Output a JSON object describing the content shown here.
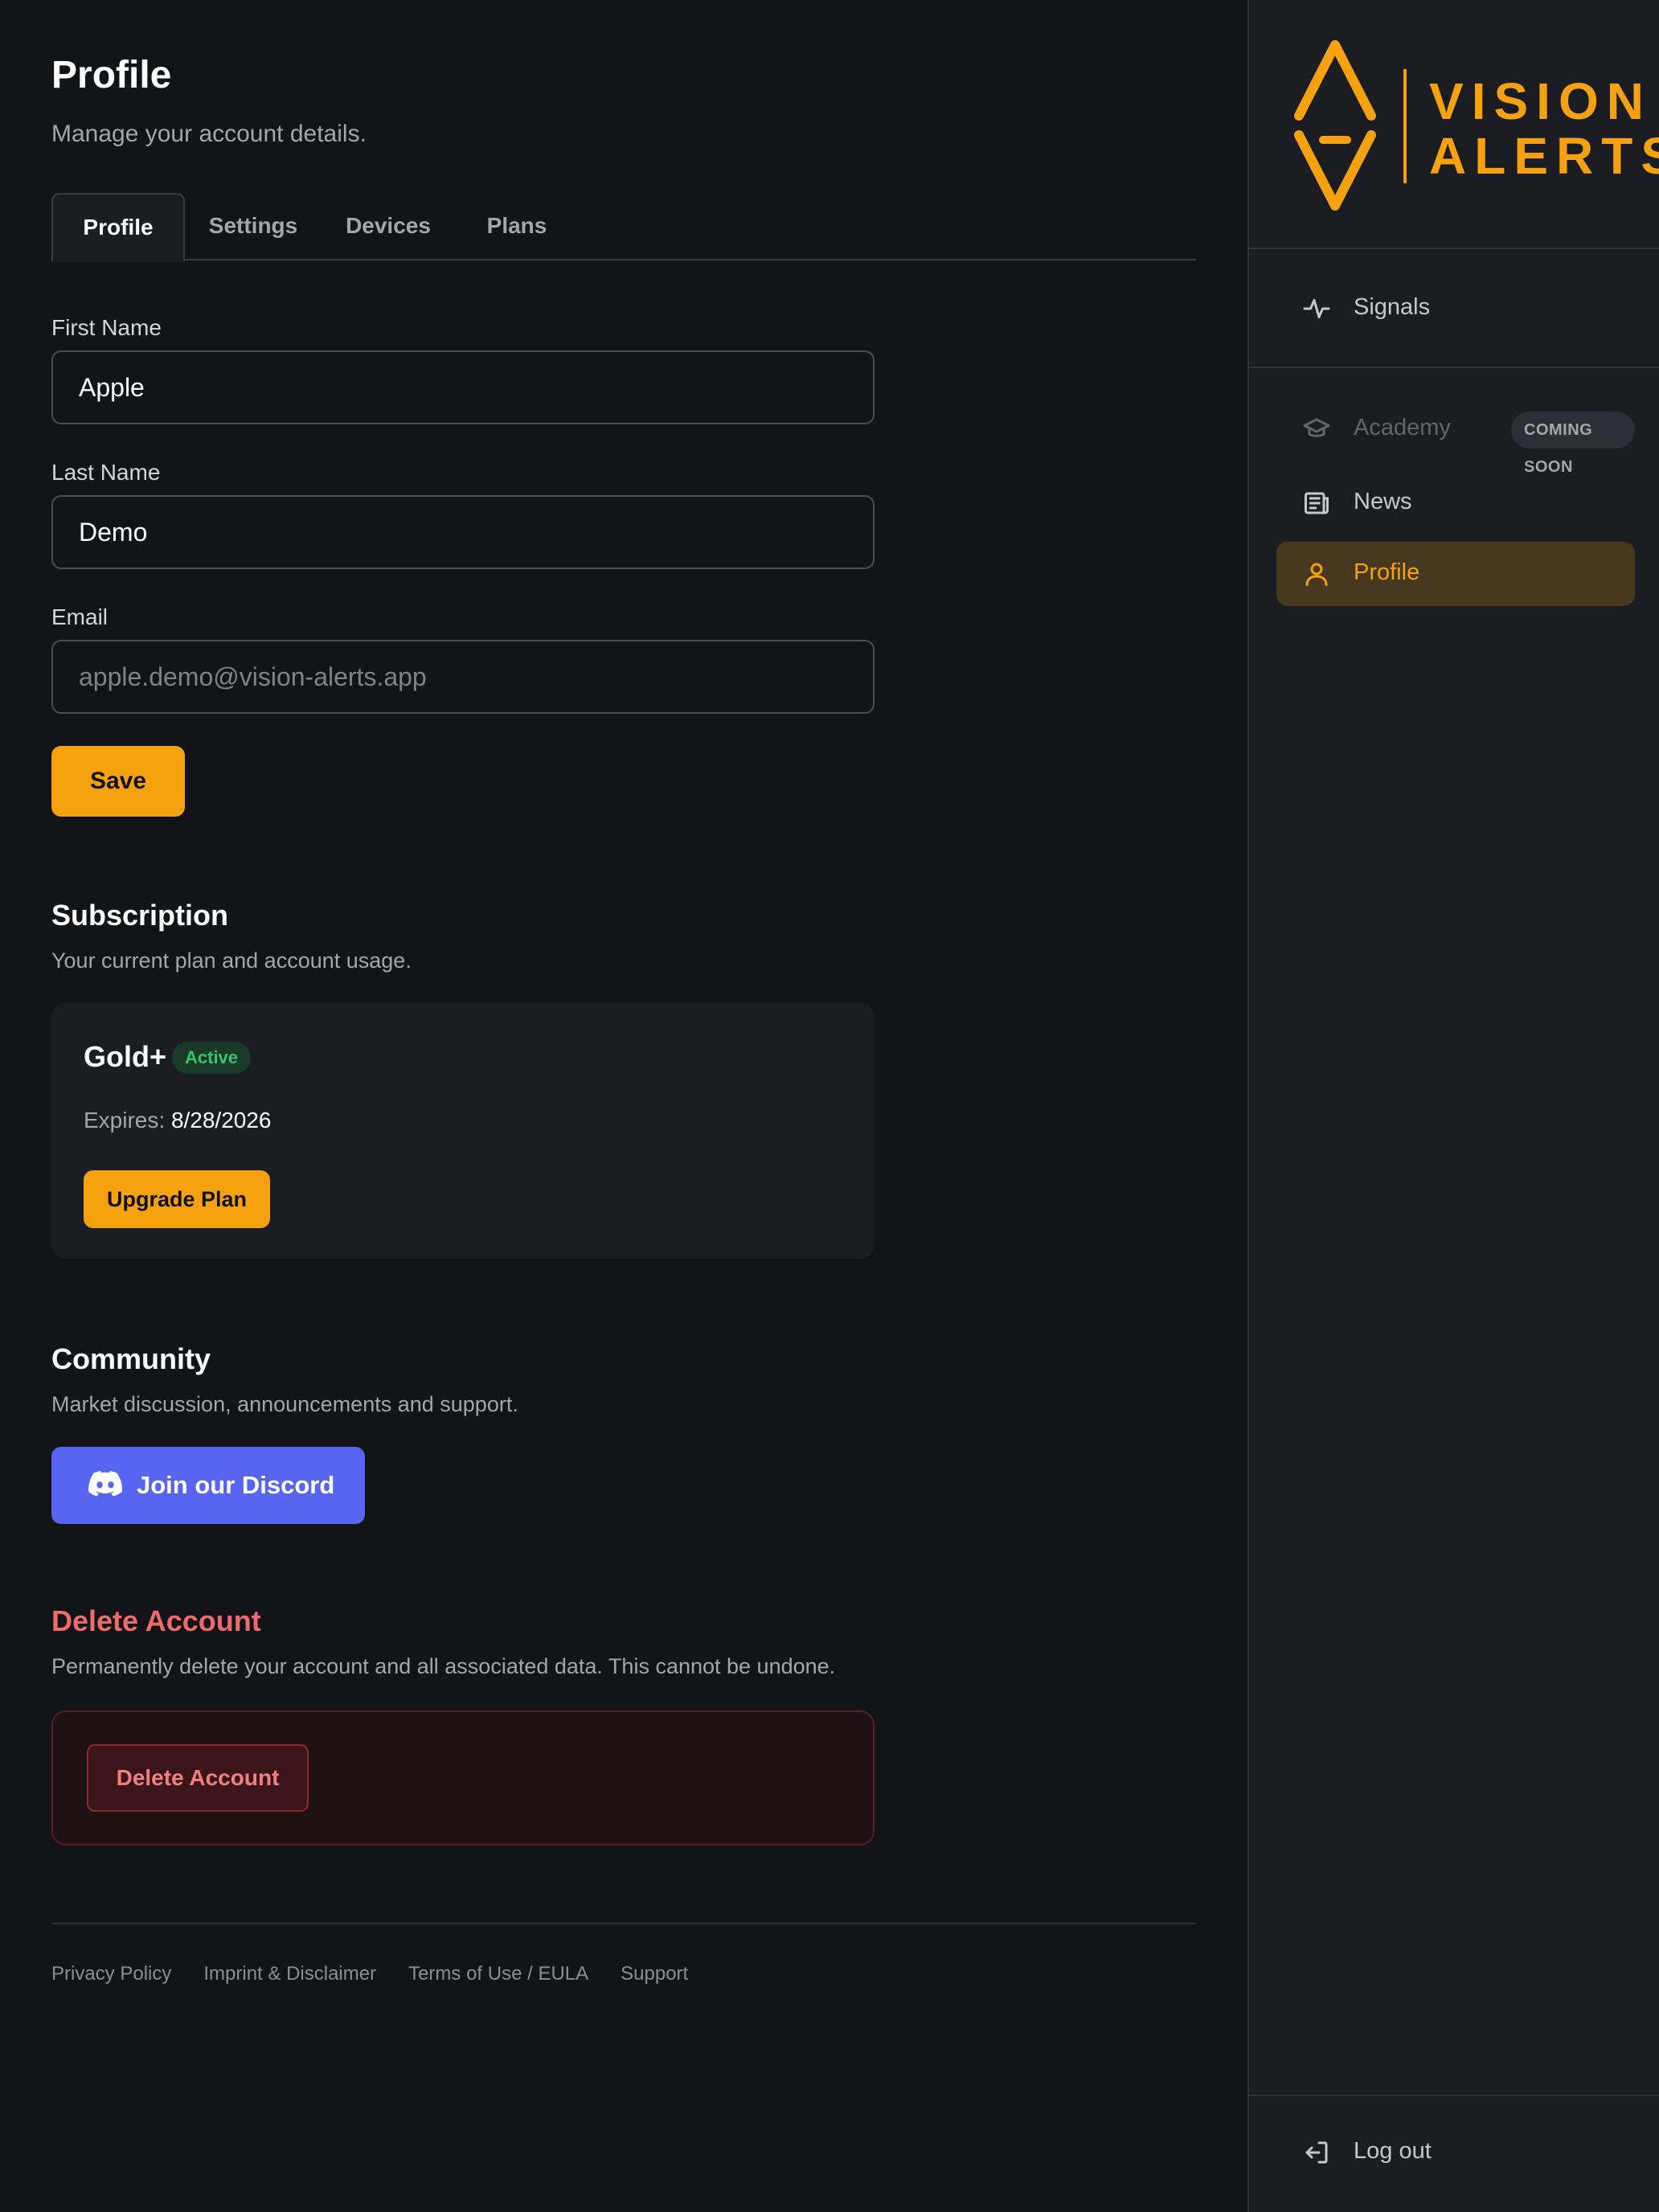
{
  "header": {
    "title": "Profile",
    "subtitle": "Manage your account details."
  },
  "tabs": [
    {
      "label": "Profile",
      "active": true
    },
    {
      "label": "Settings",
      "active": false
    },
    {
      "label": "Devices",
      "active": false
    },
    {
      "label": "Plans",
      "active": false
    }
  ],
  "form": {
    "first_name_label": "First Name",
    "first_name_value": "Apple",
    "last_name_label": "Last Name",
    "last_name_value": "Demo",
    "email_label": "Email",
    "email_value": "apple.demo@vision-alerts.app",
    "save_label": "Save"
  },
  "subscription": {
    "title": "Subscription",
    "subtitle": "Your current plan and account usage.",
    "plan_name": "Gold+",
    "status_badge": "Active",
    "expires_label": "Expires:",
    "expires_value": "8/28/2026",
    "upgrade_label": "Upgrade Plan"
  },
  "community": {
    "title": "Community",
    "subtitle": "Market discussion, announcements and support.",
    "discord_label": "Join our Discord",
    "discord_icon": "discord-icon"
  },
  "danger": {
    "title": "Delete Account",
    "subtitle": "Permanently delete your account and all associated data. This cannot be undone.",
    "delete_label": "Delete Account"
  },
  "footer": {
    "links": [
      "Privacy Policy",
      "Imprint & Disclaimer",
      "Terms of Use / EULA",
      "Support"
    ]
  },
  "sidebar": {
    "logo_line1": "VISION",
    "logo_line2": "ALERTS",
    "items": [
      {
        "label": "Signals",
        "icon": "activity-icon"
      },
      {
        "label": "Academy",
        "icon": "graduation-cap-icon",
        "badge": "COMING SOON",
        "disabled": true
      },
      {
        "label": "News",
        "icon": "newspaper-icon"
      },
      {
        "label": "Profile",
        "icon": "user-icon",
        "active": true
      }
    ],
    "logout_label": "Log out"
  },
  "colors": {
    "accent": "#f5a20e",
    "background": "#131418",
    "sidebar": "#1b1d23",
    "discord": "#5865f2",
    "danger": "#ef6b6b",
    "success": "#36c46f"
  }
}
